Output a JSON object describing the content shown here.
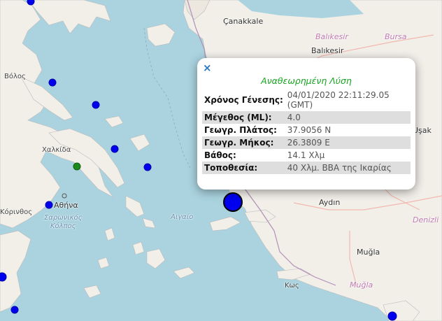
{
  "labels": {
    "canakkale": "Çanakkale",
    "bursa": "Bursa",
    "balikesir_region": "Balıkesir",
    "balikesir": "Balıkesir",
    "volos": "Βόλος",
    "chalkida": "Χαλκίδα",
    "korinthos": "Κόρινθος",
    "athina": "Αθήνα",
    "saronic": "Σαρωνικός\nΚόλπος",
    "aigaio": "Αιγαίο",
    "usak": "Uşak",
    "aydin": "Aydın",
    "denizli": "Denizli",
    "mugla": "Muğla",
    "mugla_region": "Muğla",
    "kos": "Κως"
  },
  "popup": {
    "close_label": "×",
    "title": "Αναθεωρημένη Λύση",
    "rows": [
      {
        "key": "Χρόνος Γένεσης:",
        "value": "04/01/2020 22:11:29.05 (GMT)"
      },
      {
        "key": "Μέγεθος (ML):",
        "value": "4.0"
      },
      {
        "key": "Γεωγρ. Πλάτος:",
        "value": "37.9056 N"
      },
      {
        "key": "Γεωγρ. Μήκος:",
        "value": "26.3809 E"
      },
      {
        "key": "Βάθος:",
        "value": "14.1 Χλμ"
      },
      {
        "key": "Τοποθεσία:",
        "value": "40 Χλμ. ΒΒΑ της Ικαρίας"
      }
    ]
  },
  "colors": {
    "sea": "#aad3df",
    "land": "#f2efe9",
    "quake_marker": "#0000ee",
    "older_marker": "#1a8a1a",
    "popup_title": "#18a520"
  }
}
